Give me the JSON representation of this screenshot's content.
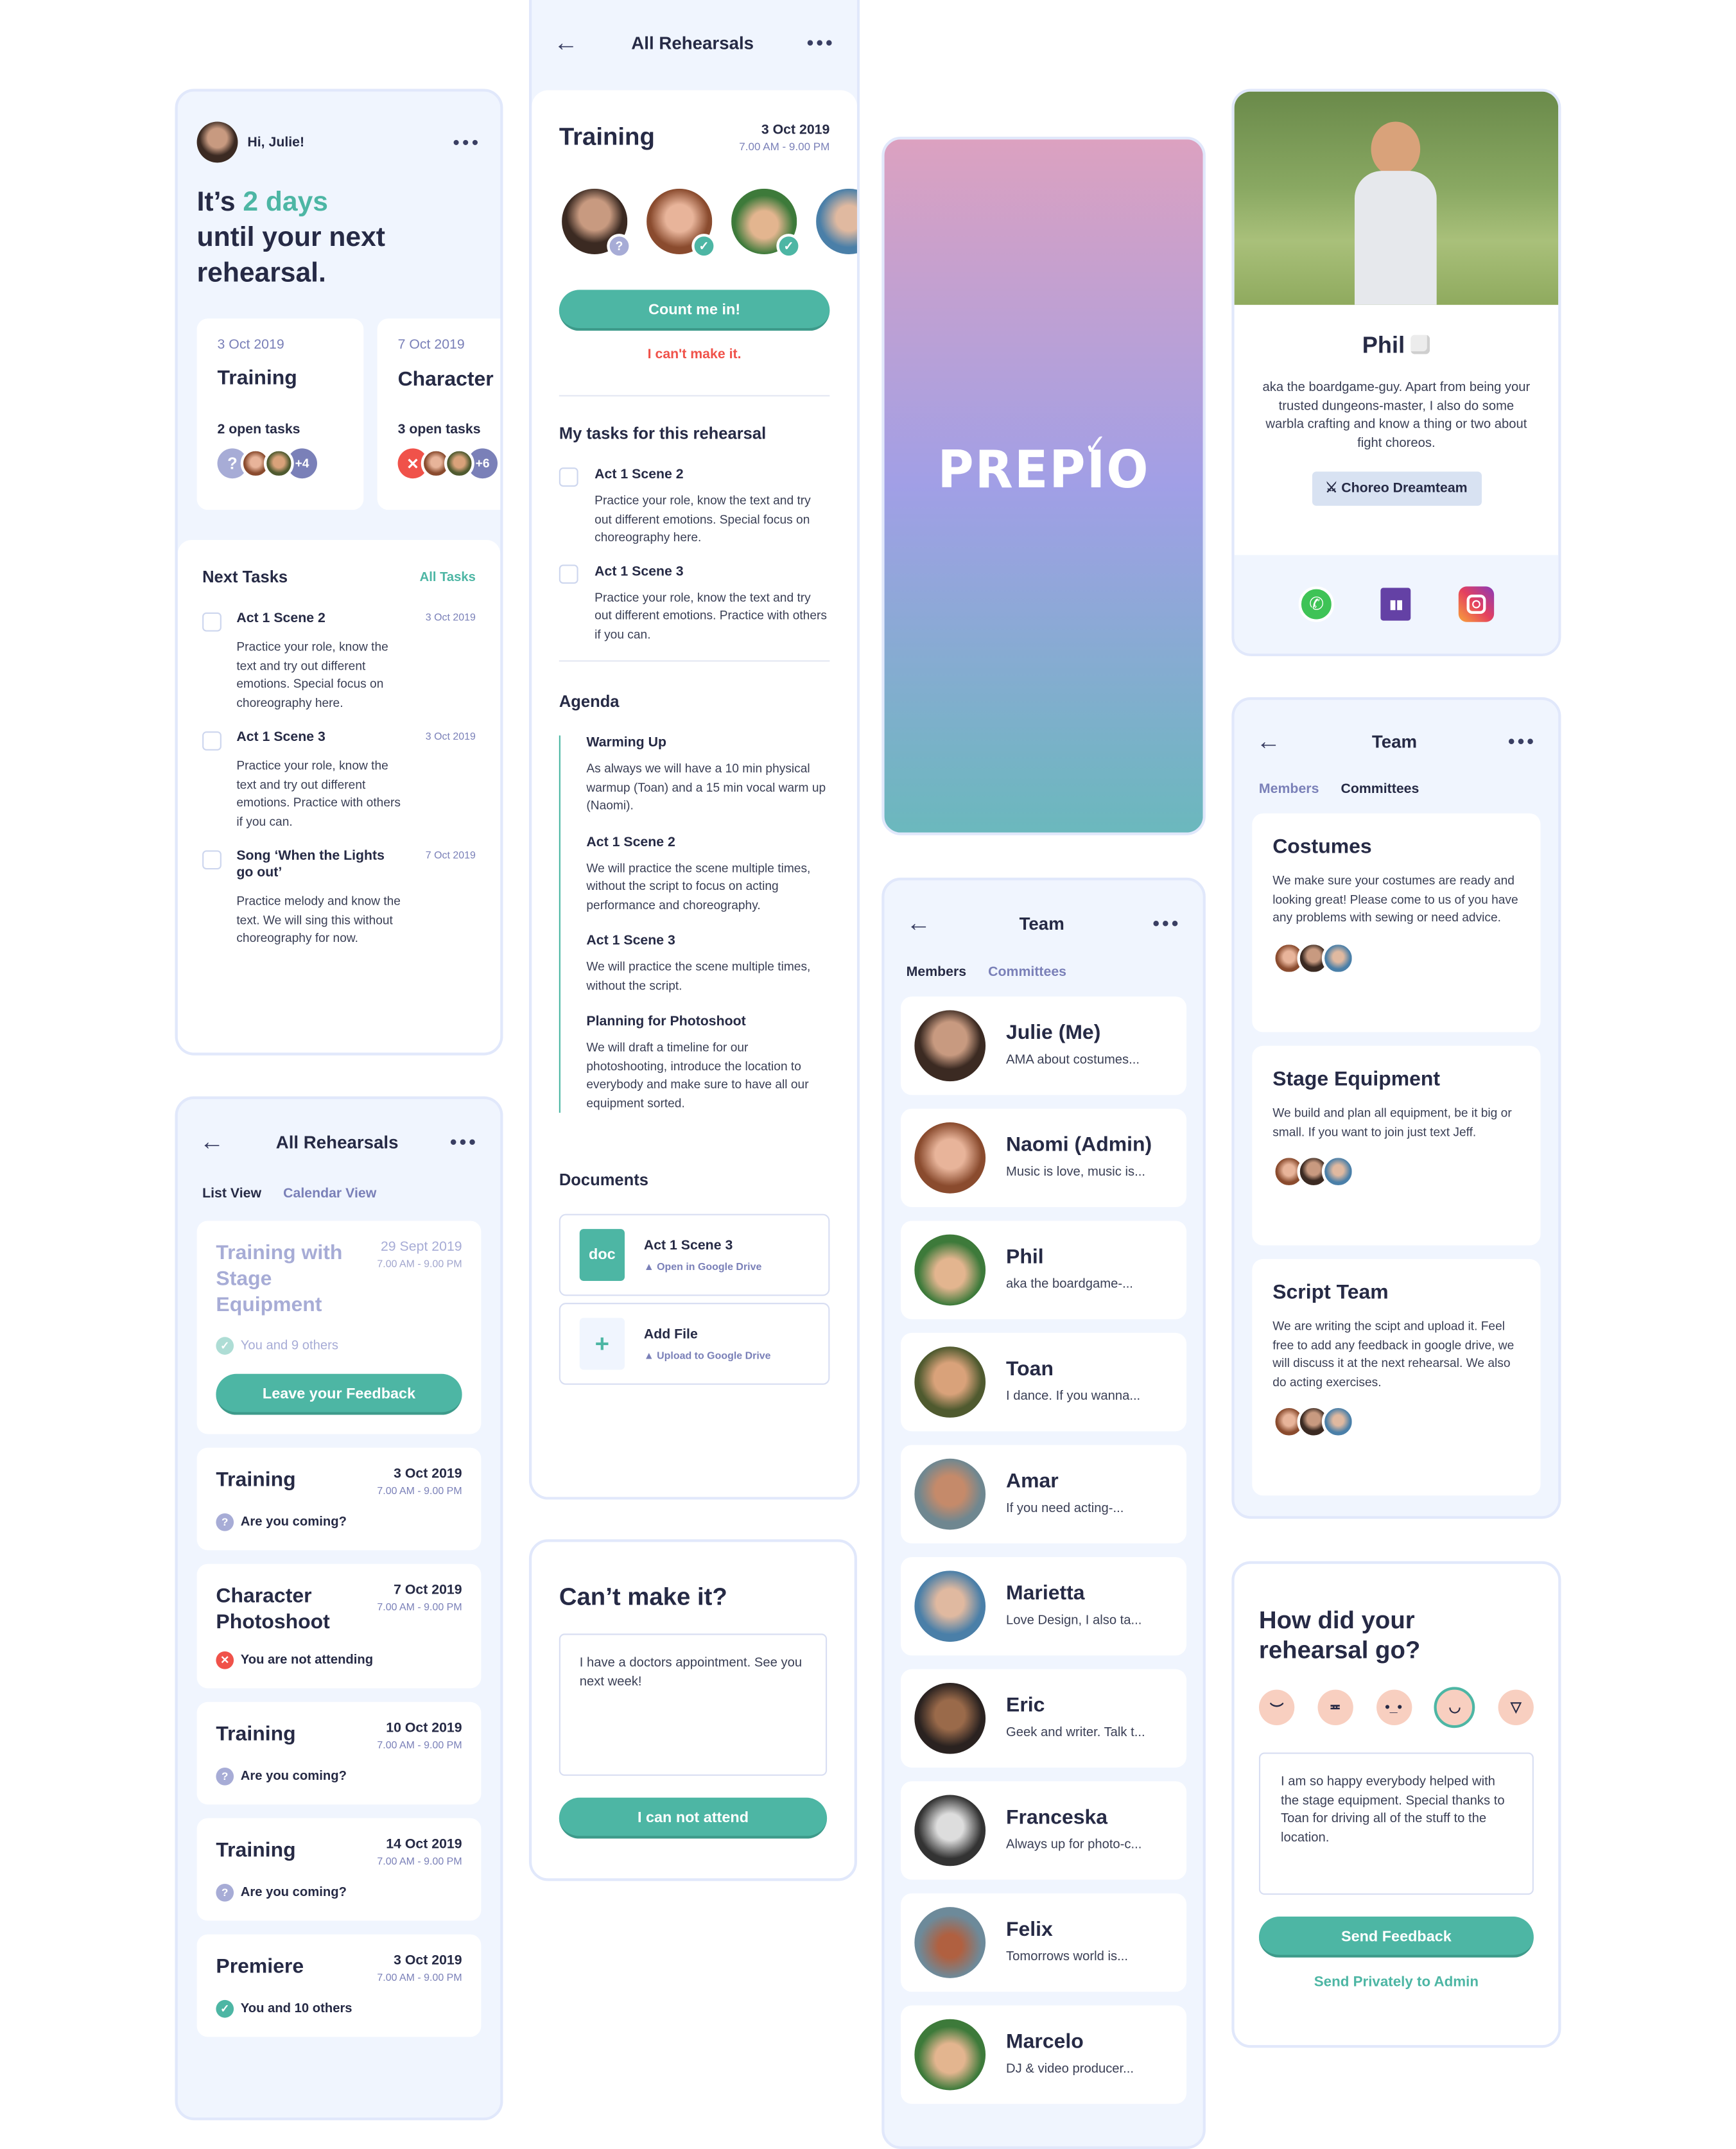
{
  "colors": {
    "accent": "#4db6a4",
    "danger": "#f0524a",
    "muted": "#7a80b8",
    "text": "#262a45",
    "panel": "#f0f5fe"
  },
  "home": {
    "greeting": "Hi, Julie!",
    "headline_pre": "It’s ",
    "headline_highlight": "2 days",
    "headline_post": "until your next rehearsal.",
    "cards": [
      {
        "date": "3 Oct 2019",
        "title": "Training",
        "tasks": "2 open tasks",
        "status_icon": "?",
        "more": "+4"
      },
      {
        "date": "7 Oct 2019",
        "title": "Character Photoshoot",
        "tasks": "3 open tasks",
        "status_icon": "✕",
        "more": "+6"
      }
    ],
    "next_tasks_title": "Next Tasks",
    "all_tasks_link": "All Tasks",
    "tasks": [
      {
        "title": "Act 1 Scene 2",
        "date": "3 Oct 2019",
        "desc": "Practice your role, know the text and try out different emotions. Special focus on choreography here."
      },
      {
        "title": "Act 1 Scene 3",
        "date": "3 Oct 2019",
        "desc": "Practice your role, know the text and try out different emotions. Practice with others if you can."
      },
      {
        "title": "Song ‘When the Lights go out’",
        "date": "7 Oct 2019",
        "desc": "Practice melody and know the text. We will sing this without choreography for now."
      }
    ]
  },
  "rehearsals": {
    "title": "All Rehearsals",
    "tabs": [
      "List View",
      "Calendar View"
    ],
    "items": [
      {
        "title": "Training with Stage Equipment",
        "date": "29 Sept 2019",
        "time": "7.00 AM - 9.00 PM",
        "status": "You and 9 others",
        "status_type": "check",
        "past": true,
        "button": "Leave your Feedback"
      },
      {
        "title": "Training",
        "date": "3 Oct 2019",
        "time": "7.00 AM - 9.00 PM",
        "status": "Are you coming?",
        "status_type": "question"
      },
      {
        "title": "Character Photoshoot",
        "date": "7 Oct 2019",
        "time": "7.00 AM - 9.00 PM",
        "status": "You are not attending",
        "status_type": "cross"
      },
      {
        "title": "Training",
        "date": "10 Oct 2019",
        "time": "7.00 AM - 9.00 PM",
        "status": "Are you coming?",
        "status_type": "question"
      },
      {
        "title": "Training",
        "date": "14 Oct 2019",
        "time": "7.00 AM - 9.00 PM",
        "status": "Are you coming?",
        "status_type": "question"
      },
      {
        "title": "Premiere",
        "date": "3 Oct 2019",
        "time": "7.00 AM - 9.00 PM",
        "status": "You and 10 others",
        "status_type": "check"
      }
    ]
  },
  "detail": {
    "header": "All Rehearsals",
    "title": "Training",
    "date": "3 Oct 2019",
    "time": "7.00 AM - 9.00 PM",
    "count_me_in": "Count me in!",
    "cant_make_it": "I can't make it.",
    "tasks_title": "My tasks for this rehearsal",
    "tasks": [
      {
        "title": "Act 1 Scene 2",
        "desc": "Practice your role, know the text and try out different emotions. Special focus on choreography here."
      },
      {
        "title": "Act 1 Scene 3",
        "desc": "Practice your role, know the text and try out different emotions. Practice with others if you can."
      }
    ],
    "agenda_title": "Agenda",
    "agenda": [
      {
        "title": "Warming Up",
        "desc": "As always we will have a 10 min physical warmup (Toan) and a 15 min vocal warm up (Naomi)."
      },
      {
        "title": "Act 1 Scene 2",
        "desc": "We will practice the scene multiple times, without the script to focus on acting performance and choreography."
      },
      {
        "title": "Act 1 Scene 3",
        "desc": "We will practice the scene multiple times, without the script."
      },
      {
        "title": "Planning for Photoshoot",
        "desc": "We will draft a timeline for our photoshooting, introduce the location to everybody and make sure to have all our equipment sorted."
      }
    ],
    "documents_title": "Documents",
    "documents": [
      {
        "badge": "doc",
        "title": "Act 1 Scene 3",
        "action": "Open in Google Drive"
      },
      {
        "badge": "+",
        "title": "Add File",
        "action": "Upload to Google Drive"
      }
    ]
  },
  "cant": {
    "title": "Can’t make it?",
    "text": "I have a doctors appointment. See you next week!",
    "button": "I can not attend"
  },
  "splash": {
    "logo": "PREPIO"
  },
  "team": {
    "title": "Team",
    "tabs": [
      "Members",
      "Committees"
    ],
    "members": [
      {
        "name": "Julie (Me)",
        "desc": "AMA about costumes..."
      },
      {
        "name": "Naomi (Admin)",
        "desc": "Music is love, music is..."
      },
      {
        "name": "Phil",
        "desc": "aka the boardgame-..."
      },
      {
        "name": "Toan",
        "desc": "I dance. If you wanna..."
      },
      {
        "name": "Amar",
        "desc": "If you need acting-..."
      },
      {
        "name": "Marietta",
        "desc": "Love Design, I also ta..."
      },
      {
        "name": "Eric",
        "desc": "Geek and writer. Talk t..."
      },
      {
        "name": "Franceska",
        "desc": "Always up for photo-c..."
      },
      {
        "name": "Felix",
        "desc": "Tomorrows world is..."
      },
      {
        "name": "Marcelo",
        "desc": "DJ & video producer..."
      }
    ]
  },
  "profile": {
    "name": "Phil",
    "bio": "aka the boardgame-guy. Apart from being your trusted dungeons-master, I also do some warbla crafting and know a thing or two about fight choreos.",
    "badge": "⚔ Choreo Dreamteam",
    "socials": [
      "whatsapp",
      "twitch",
      "instagram"
    ]
  },
  "committees": {
    "title": "Team",
    "tabs": [
      "Members",
      "Committees"
    ],
    "items": [
      {
        "name": "Costumes",
        "desc": "We make sure your costumes are ready and looking great! Please come to us of you have any problems with sewing or need advice."
      },
      {
        "name": "Stage Equipment",
        "desc": "We build and plan all equipment, be it big or small. If you want to join just text Jeff."
      },
      {
        "name": "Script Team",
        "desc": "We are writing the scipt and upload it. Feel free to add any feedback in google drive, we will discuss it at the next rehearsal. We also do acting exercises."
      }
    ]
  },
  "feedback": {
    "title": "How did your rehearsal go?",
    "moods": [
      "sad",
      "angry",
      "neutral",
      "happy",
      "excited"
    ],
    "selected_mood": "happy",
    "text": "I am so happy everybody helped with the stage equipment. Special thanks to Toan for driving all of the stuff to the location.",
    "button": "Send Feedback",
    "link": "Send Privately to Admin"
  }
}
